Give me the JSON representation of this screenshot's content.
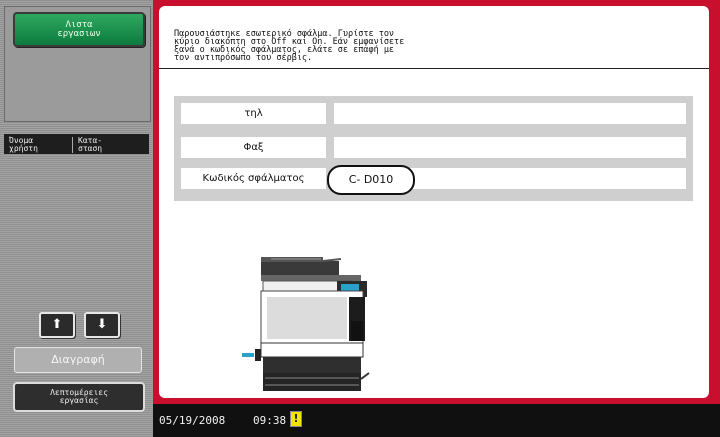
{
  "left_panel": {
    "job_list_button": [
      "Λιστα",
      "εργασιων"
    ],
    "column_headers": {
      "user_name": [
        "Όνομα",
        "χρήστη"
      ],
      "status": [
        "Κατα-",
        "σταση"
      ]
    },
    "scroll_up_icon": "arrow-up",
    "scroll_down_icon": "arrow-down",
    "delete_button": "Διαγραφή",
    "job_details_button": [
      "Λεπτομέρειες",
      "εργασίας"
    ]
  },
  "main": {
    "message_lines": [
      "Παρουσιάστηκε εσωτερικό σφάλμα. Γυρίστε τον",
      "κύριο διακόπτη στο Off και On. Εάν εμφανίσετε",
      "ξανά ο κωδικός σφάλματος, ελάτε σε επαφή με",
      "τον αντιπρόσωπο του σέρβις."
    ],
    "rows": [
      {
        "label": "τηλ",
        "value": ""
      },
      {
        "label": "Φαξ",
        "value": ""
      },
      {
        "label": "Κωδικός σφάλματος",
        "value": "C- D010"
      }
    ]
  },
  "status_bar": {
    "date": "05/19/2008",
    "time": "09:38",
    "warning_icon": "!"
  },
  "colors": {
    "frame": "#c8102e",
    "job_button": "#0d7b3e"
  }
}
